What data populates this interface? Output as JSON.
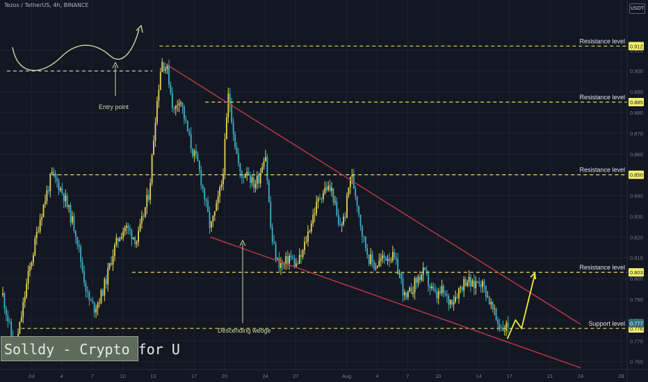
{
  "header": {
    "symbol": "Tezos / TetherUS",
    "interval": "4h",
    "exchange": "BINANCE",
    "separator": ", "
  },
  "currency_button": "USDT",
  "watermark_text": "Solldy - Crypto for U",
  "colors": {
    "background": "#131722",
    "grid": "#1f2330",
    "candle_up": "#e6d55a",
    "candle_down": "#3fb1c7",
    "level_line": "#e8e35a",
    "wedge_line": "#c23a4d",
    "arrow": "#f2ef3a",
    "annotation": "#c9d9a6",
    "axis_text": "#787b86"
  },
  "chart_data": {
    "type": "candlestick",
    "y_axis": {
      "min": 0.755,
      "max": 0.92,
      "ticks": [
        "0.760",
        "0.770",
        "0.780",
        "0.790",
        "0.800",
        "0.810",
        "0.820",
        "0.830",
        "0.840",
        "0.850",
        "0.860",
        "0.870",
        "0.880",
        "0.890",
        "0.900",
        "0.910"
      ]
    },
    "x_axis": {
      "ticks": [
        {
          "label": "Jul",
          "day": 1
        },
        {
          "label": "4",
          "day": 4
        },
        {
          "label": "7",
          "day": 7
        },
        {
          "label": "10",
          "day": 10
        },
        {
          "label": "13",
          "day": 13
        },
        {
          "label": "17",
          "day": 17
        },
        {
          "label": "20",
          "day": 20
        },
        {
          "label": "24",
          "day": 24
        },
        {
          "label": "27",
          "day": 27
        },
        {
          "label": "Aug",
          "day": 32
        },
        {
          "label": "4",
          "day": 35
        },
        {
          "label": "7",
          "day": 38
        },
        {
          "label": "10",
          "day": 41
        },
        {
          "label": "14",
          "day": 45
        },
        {
          "label": "17",
          "day": 48
        },
        {
          "label": "21",
          "day": 52
        },
        {
          "label": "24",
          "day": 55
        },
        {
          "label": "28",
          "day": 59
        }
      ]
    },
    "price_path": [
      [
        -1.8,
        0.792
      ],
      [
        -1.2,
        0.778
      ],
      [
        -0.6,
        0.764
      ],
      [
        0.0,
        0.781
      ],
      [
        0.6,
        0.799
      ],
      [
        1.2,
        0.813
      ],
      [
        1.8,
        0.828
      ],
      [
        2.4,
        0.839
      ],
      [
        3.0,
        0.85
      ],
      [
        3.6,
        0.846
      ],
      [
        4.2,
        0.84
      ],
      [
        4.8,
        0.831
      ],
      [
        5.4,
        0.822
      ],
      [
        6.0,
        0.805
      ],
      [
        6.6,
        0.79
      ],
      [
        7.2,
        0.786
      ],
      [
        7.8,
        0.791
      ],
      [
        8.4,
        0.8
      ],
      [
        9.0,
        0.812
      ],
      [
        9.6,
        0.82
      ],
      [
        10.2,
        0.825
      ],
      [
        10.8,
        0.822
      ],
      [
        11.4,
        0.818
      ],
      [
        12.0,
        0.83
      ],
      [
        12.6,
        0.842
      ],
      [
        13.2,
        0.878
      ],
      [
        13.8,
        0.905
      ],
      [
        14.4,
        0.9
      ],
      [
        15.0,
        0.88
      ],
      [
        15.6,
        0.888
      ],
      [
        16.2,
        0.874
      ],
      [
        16.8,
        0.862
      ],
      [
        17.4,
        0.855
      ],
      [
        18.0,
        0.84
      ],
      [
        18.6,
        0.824
      ],
      [
        19.2,
        0.834
      ],
      [
        19.8,
        0.848
      ],
      [
        20.4,
        0.89
      ],
      [
        21.0,
        0.866
      ],
      [
        21.6,
        0.848
      ],
      [
        22.2,
        0.853
      ],
      [
        22.8,
        0.845
      ],
      [
        23.4,
        0.849
      ],
      [
        24.0,
        0.862
      ],
      [
        24.6,
        0.82
      ],
      [
        25.2,
        0.808
      ],
      [
        25.8,
        0.806
      ],
      [
        26.4,
        0.811
      ],
      [
        27.0,
        0.806
      ],
      [
        27.6,
        0.811
      ],
      [
        28.2,
        0.822
      ],
      [
        28.8,
        0.832
      ],
      [
        29.4,
        0.84
      ],
      [
        30.0,
        0.844
      ],
      [
        30.6,
        0.842
      ],
      [
        31.2,
        0.825
      ],
      [
        31.8,
        0.829
      ],
      [
        32.4,
        0.851
      ],
      [
        33.0,
        0.838
      ],
      [
        33.6,
        0.82
      ],
      [
        34.2,
        0.81
      ],
      [
        34.8,
        0.806
      ],
      [
        35.4,
        0.809
      ],
      [
        36.0,
        0.811
      ],
      [
        36.6,
        0.81
      ],
      [
        37.2,
        0.802
      ],
      [
        37.8,
        0.789
      ],
      [
        38.4,
        0.795
      ],
      [
        39.0,
        0.8
      ],
      [
        39.6,
        0.803
      ],
      [
        40.2,
        0.796
      ],
      [
        40.8,
        0.791
      ],
      [
        41.4,
        0.794
      ],
      [
        42.0,
        0.789
      ],
      [
        42.6,
        0.791
      ],
      [
        43.2,
        0.796
      ],
      [
        43.8,
        0.8
      ],
      [
        44.4,
        0.796
      ],
      [
        45.0,
        0.8
      ],
      [
        45.6,
        0.795
      ],
      [
        46.2,
        0.787
      ],
      [
        46.8,
        0.779
      ],
      [
        47.4,
        0.776
      ],
      [
        48.0,
        0.778
      ]
    ],
    "levels": [
      {
        "name": "Resistance level",
        "price": 0.912,
        "label": "0.912",
        "from_day": 13.6
      },
      {
        "name": "Resistance level",
        "price": 0.885,
        "label": "0.885",
        "from_day": 18.1
      },
      {
        "name": "Resistance level",
        "price": 0.85,
        "label": "0.850",
        "from_day": 3.0
      },
      {
        "name": "Resistance level",
        "price": 0.803,
        "label": "0.803",
        "from_day": 10.9
      },
      {
        "name": "Support level",
        "price": 0.776,
        "label": "0.776",
        "from_day": 0.0
      }
    ],
    "entry_level": {
      "price": 0.9,
      "from_day": -1.4,
      "to_day": 12.9
    },
    "current_price_label": "0.777",
    "annotations": {
      "entry": "Entry point",
      "wedge": "Descending wedge"
    },
    "wedge": {
      "upper": [
        [
          14.0,
          0.904
        ],
        [
          55.0,
          0.778
        ]
      ],
      "lower": [
        [
          18.6,
          0.82
        ],
        [
          55.0,
          0.757
        ]
      ]
    },
    "projection": [
      [
        47.8,
        0.771
      ],
      [
        48.6,
        0.78
      ],
      [
        49.2,
        0.776
      ],
      [
        50.5,
        0.802
      ]
    ]
  }
}
